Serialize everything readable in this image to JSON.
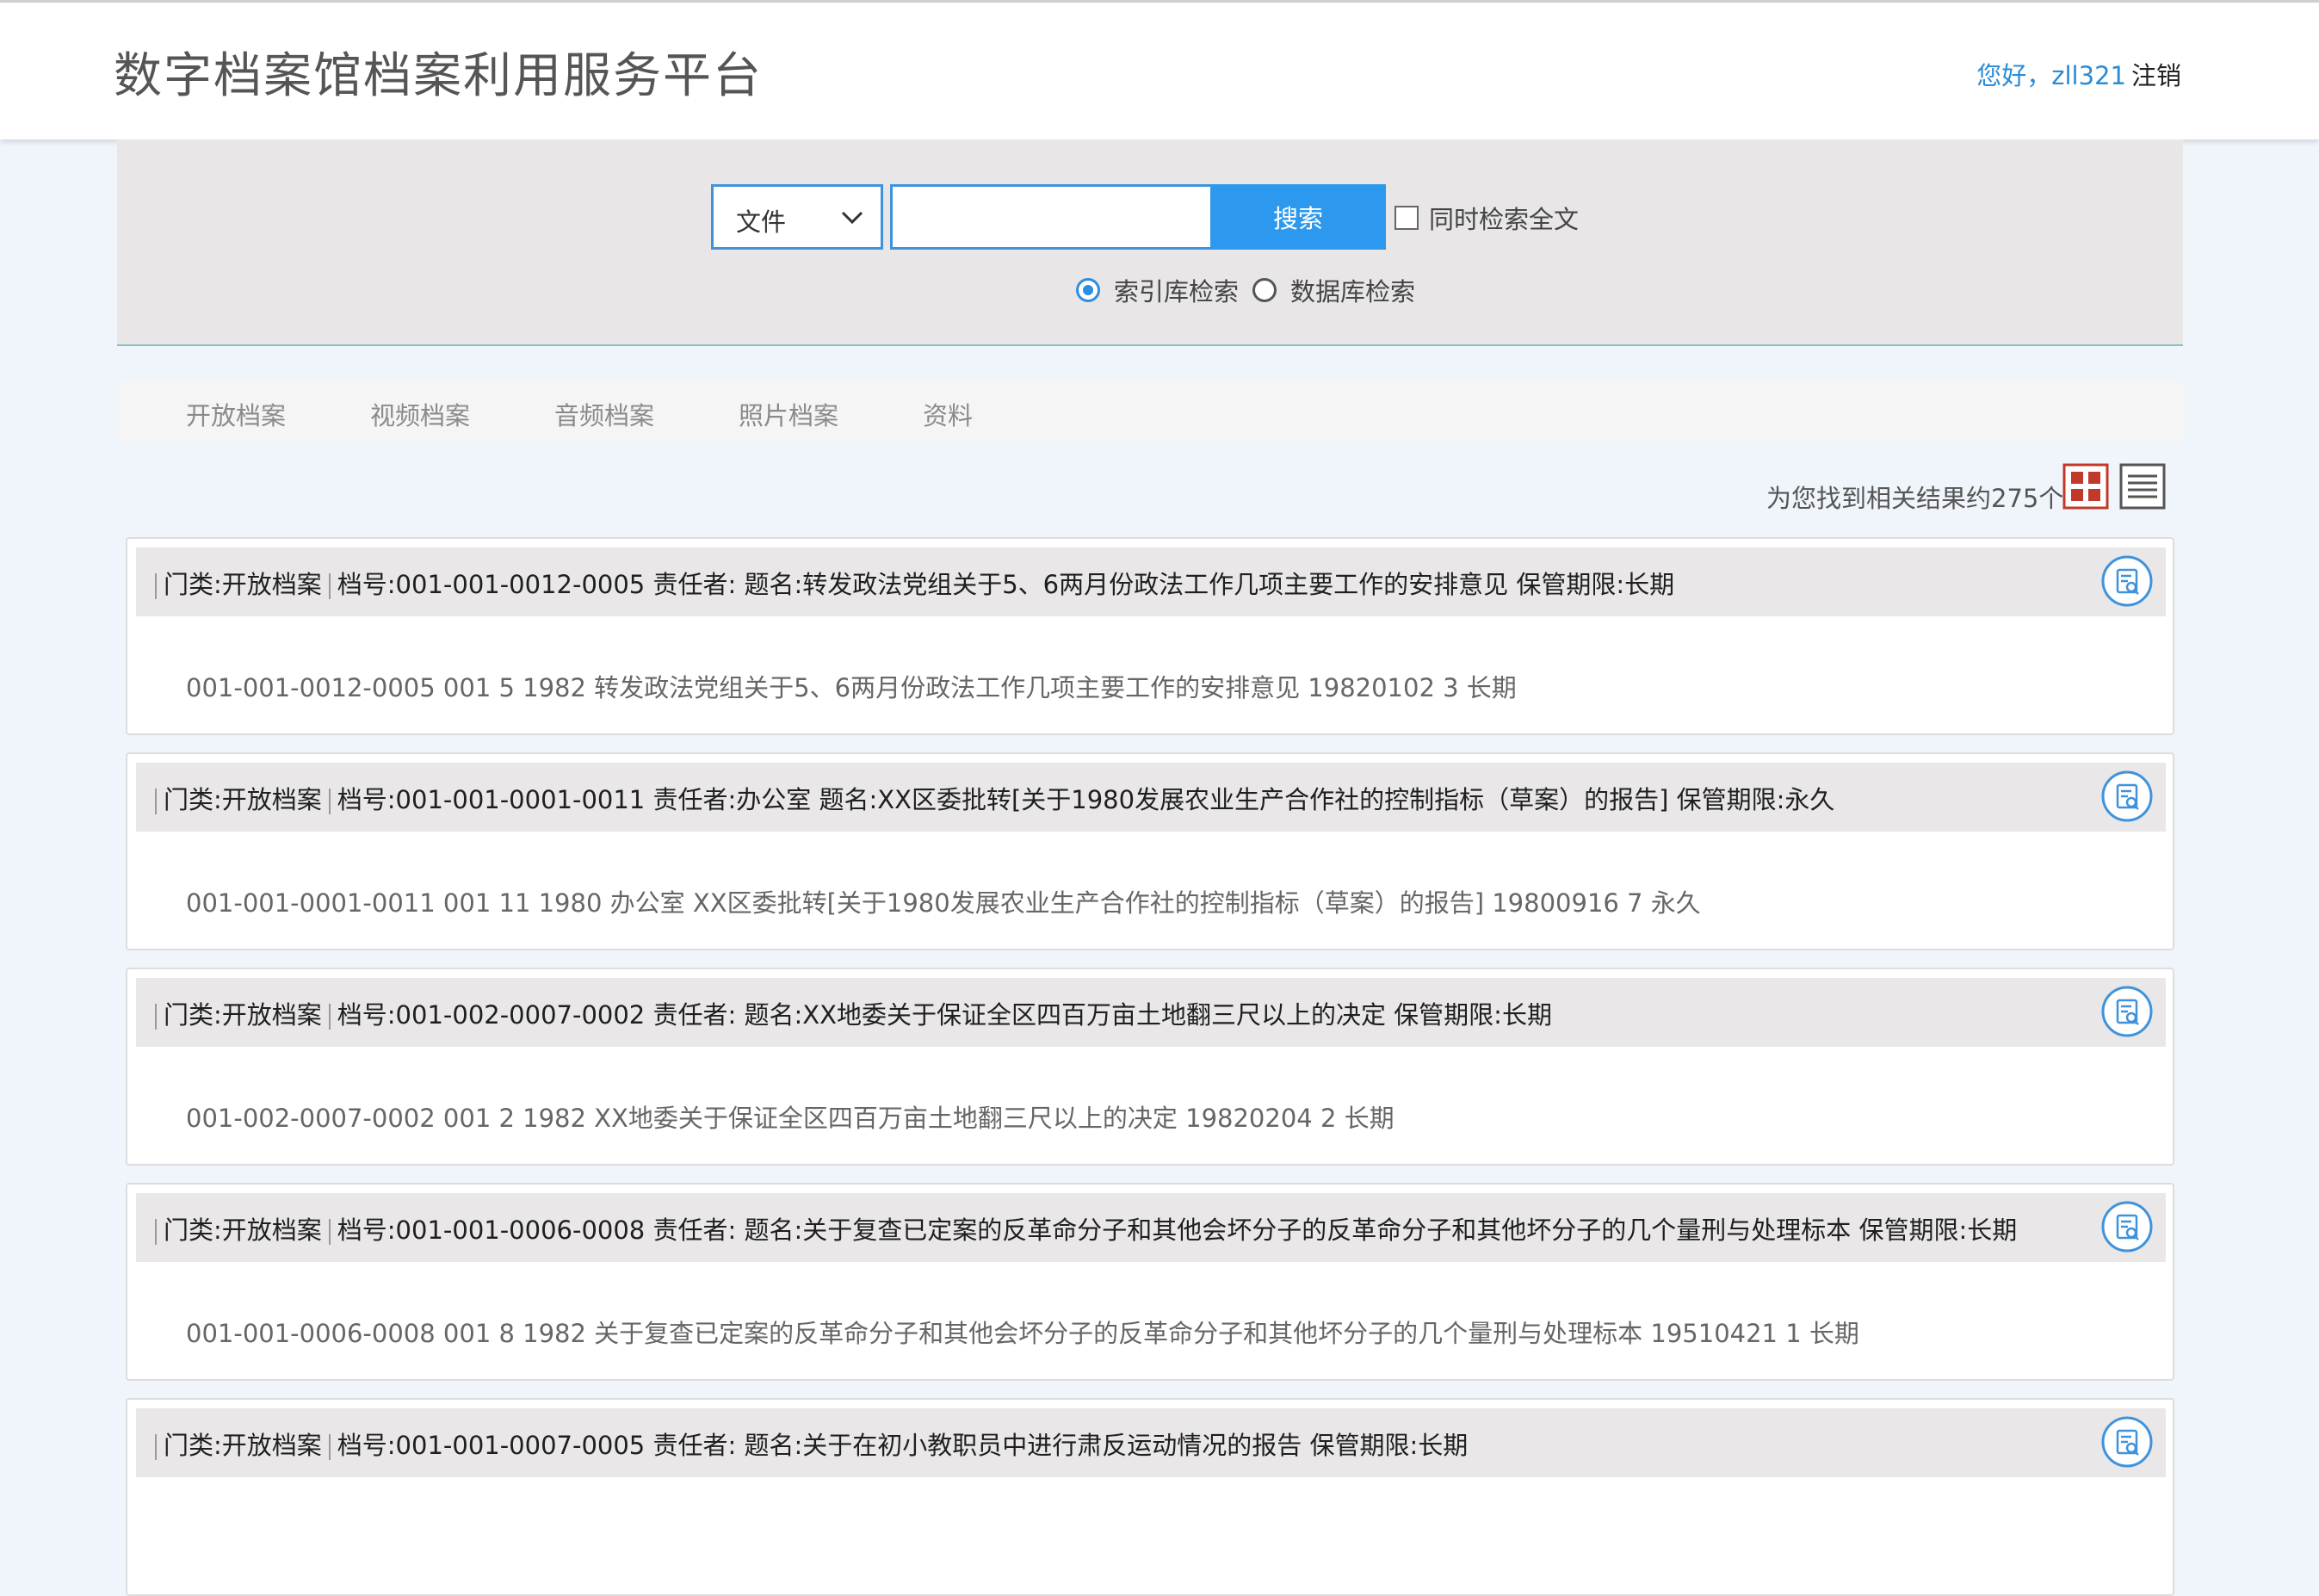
{
  "header": {
    "title": "数字档案馆档案利用服务平台",
    "greeting": "您好，zll321",
    "logout": "注销"
  },
  "search": {
    "type_selected": "文件",
    "query": "",
    "button": "搜索",
    "fulltext_label": "同时检索全文",
    "fulltext_checked": false,
    "modes": [
      {
        "label": "索引库检索",
        "selected": true
      },
      {
        "label": "数据库检索",
        "selected": false
      }
    ]
  },
  "tabs": [
    {
      "label": "开放档案"
    },
    {
      "label": "视频档案"
    },
    {
      "label": "音频档案"
    },
    {
      "label": "照片档案"
    },
    {
      "label": "资料"
    }
  ],
  "results": {
    "summary": "为您找到相关结果约275个",
    "view": {
      "active": "grid",
      "active_color": "#c0392b",
      "accent": "#2d99ee"
    },
    "items": [
      {
        "category": "门类:开放档案",
        "meta": "档号:001-001-0012-0005 责任者: 题名:转发政法党组关于5、6两月份政法工作几项主要工作的安排意见 保管期限:长期",
        "detail": "001-001-0012-0005 001 5 1982 转发政法党组关于5、6两月份政法工作几项主要工作的安排意见 19820102 3 长期"
      },
      {
        "category": "门类:开放档案",
        "meta": "档号:001-001-0001-0011 责任者:办公室 题名:XX区委批转[关于1980发展农业生产合作社的控制指标（草案）的报告] 保管期限:永久",
        "detail": "001-001-0001-0011 001 11 1980 办公室 XX区委批转[关于1980发展农业生产合作社的控制指标（草案）的报告] 19800916 7 永久"
      },
      {
        "category": "门类:开放档案",
        "meta": "档号:001-002-0007-0002 责任者: 题名:XX地委关于保证全区四百万亩土地翻三尺以上的决定 保管期限:长期",
        "detail": "001-002-0007-0002 001 2 1982 XX地委关于保证全区四百万亩土地翻三尺以上的决定 19820204 2 长期"
      },
      {
        "category": "门类:开放档案",
        "meta": "档号:001-001-0006-0008 责任者: 题名:关于复查已定案的反革命分子和其他会坏分子的反革命分子和其他坏分子的几个量刑与处理标本 保管期限:长期",
        "detail": "001-001-0006-0008 001 8 1982 关于复查已定案的反革命分子和其他会坏分子的反革命分子和其他坏分子的几个量刑与处理标本 19510421 1 长期"
      },
      {
        "category": "门类:开放档案",
        "meta": "档号:001-001-0007-0005 责任者: 题名:关于在初小教职员中进行肃反运动情况的报告 保管期限:长期",
        "detail": ""
      }
    ]
  }
}
